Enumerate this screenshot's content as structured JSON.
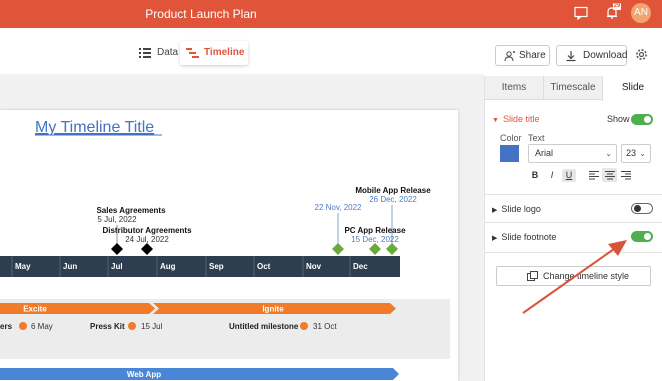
{
  "app": {
    "title": "Product Launch Plan",
    "user_initials": "AN",
    "notification_count": "29"
  },
  "view_tabs": {
    "data_label": "Data",
    "timeline_label": "Timeline"
  },
  "toolbar": {
    "share_label": "Share",
    "download_label": "Download"
  },
  "slide": {
    "title": "My Timeline Title",
    "months": [
      "May",
      "Jun",
      "Jul",
      "Aug",
      "Sep",
      "Oct",
      "Nov",
      "Dec"
    ],
    "milestones": [
      {
        "name": "Sales Agreements",
        "date": "5 Jul, 2022",
        "color": "#000000"
      },
      {
        "name": "Distributor Agreements",
        "date": "24 Jul, 2022",
        "color": "#000000"
      },
      {
        "name": "",
        "date": "22 Nov, 2022",
        "color": "#6aaa3a"
      },
      {
        "name": "Mobile App Release",
        "date": "26 Dec, 2022",
        "color": "#6aaa3a"
      },
      {
        "name": "PC App Release",
        "date": "15 Dec, 2022",
        "color": "#6aaa3a"
      }
    ],
    "bars": [
      {
        "label": "Excite",
        "color": "#f07c2a"
      },
      {
        "label": "Ignite",
        "color": "#f07c2a"
      },
      {
        "label": "Web App",
        "color": "#4a86d6"
      }
    ],
    "tasks": [
      {
        "name": "ers",
        "date": "6 May"
      },
      {
        "name": "Press Kit",
        "date": "15 Jul"
      },
      {
        "name": "Untitled milestone",
        "date": "31 Oct"
      }
    ]
  },
  "panel": {
    "tabs": [
      "Items",
      "Timescale",
      "Slide"
    ],
    "active_tab": "Slide",
    "slide_title_section": "Slide title",
    "show_label": "Show",
    "color_label": "Color",
    "text_label": "Text",
    "font": "Arial",
    "font_size": "23",
    "title_color": "#4472c4",
    "format": [
      "B",
      "I",
      "U"
    ],
    "slide_logo_section": "Slide logo",
    "slide_footnote_section": "Slide footnote",
    "slide_title_show": true,
    "slide_logo_show": false,
    "slide_footnote_show": true,
    "change_style_label": "Change timeline style"
  },
  "colors": {
    "accent": "#e0553a",
    "timescale": "#2d3e50",
    "toggle_on": "#4caf50",
    "annotation_arrow": "#d9533a"
  }
}
